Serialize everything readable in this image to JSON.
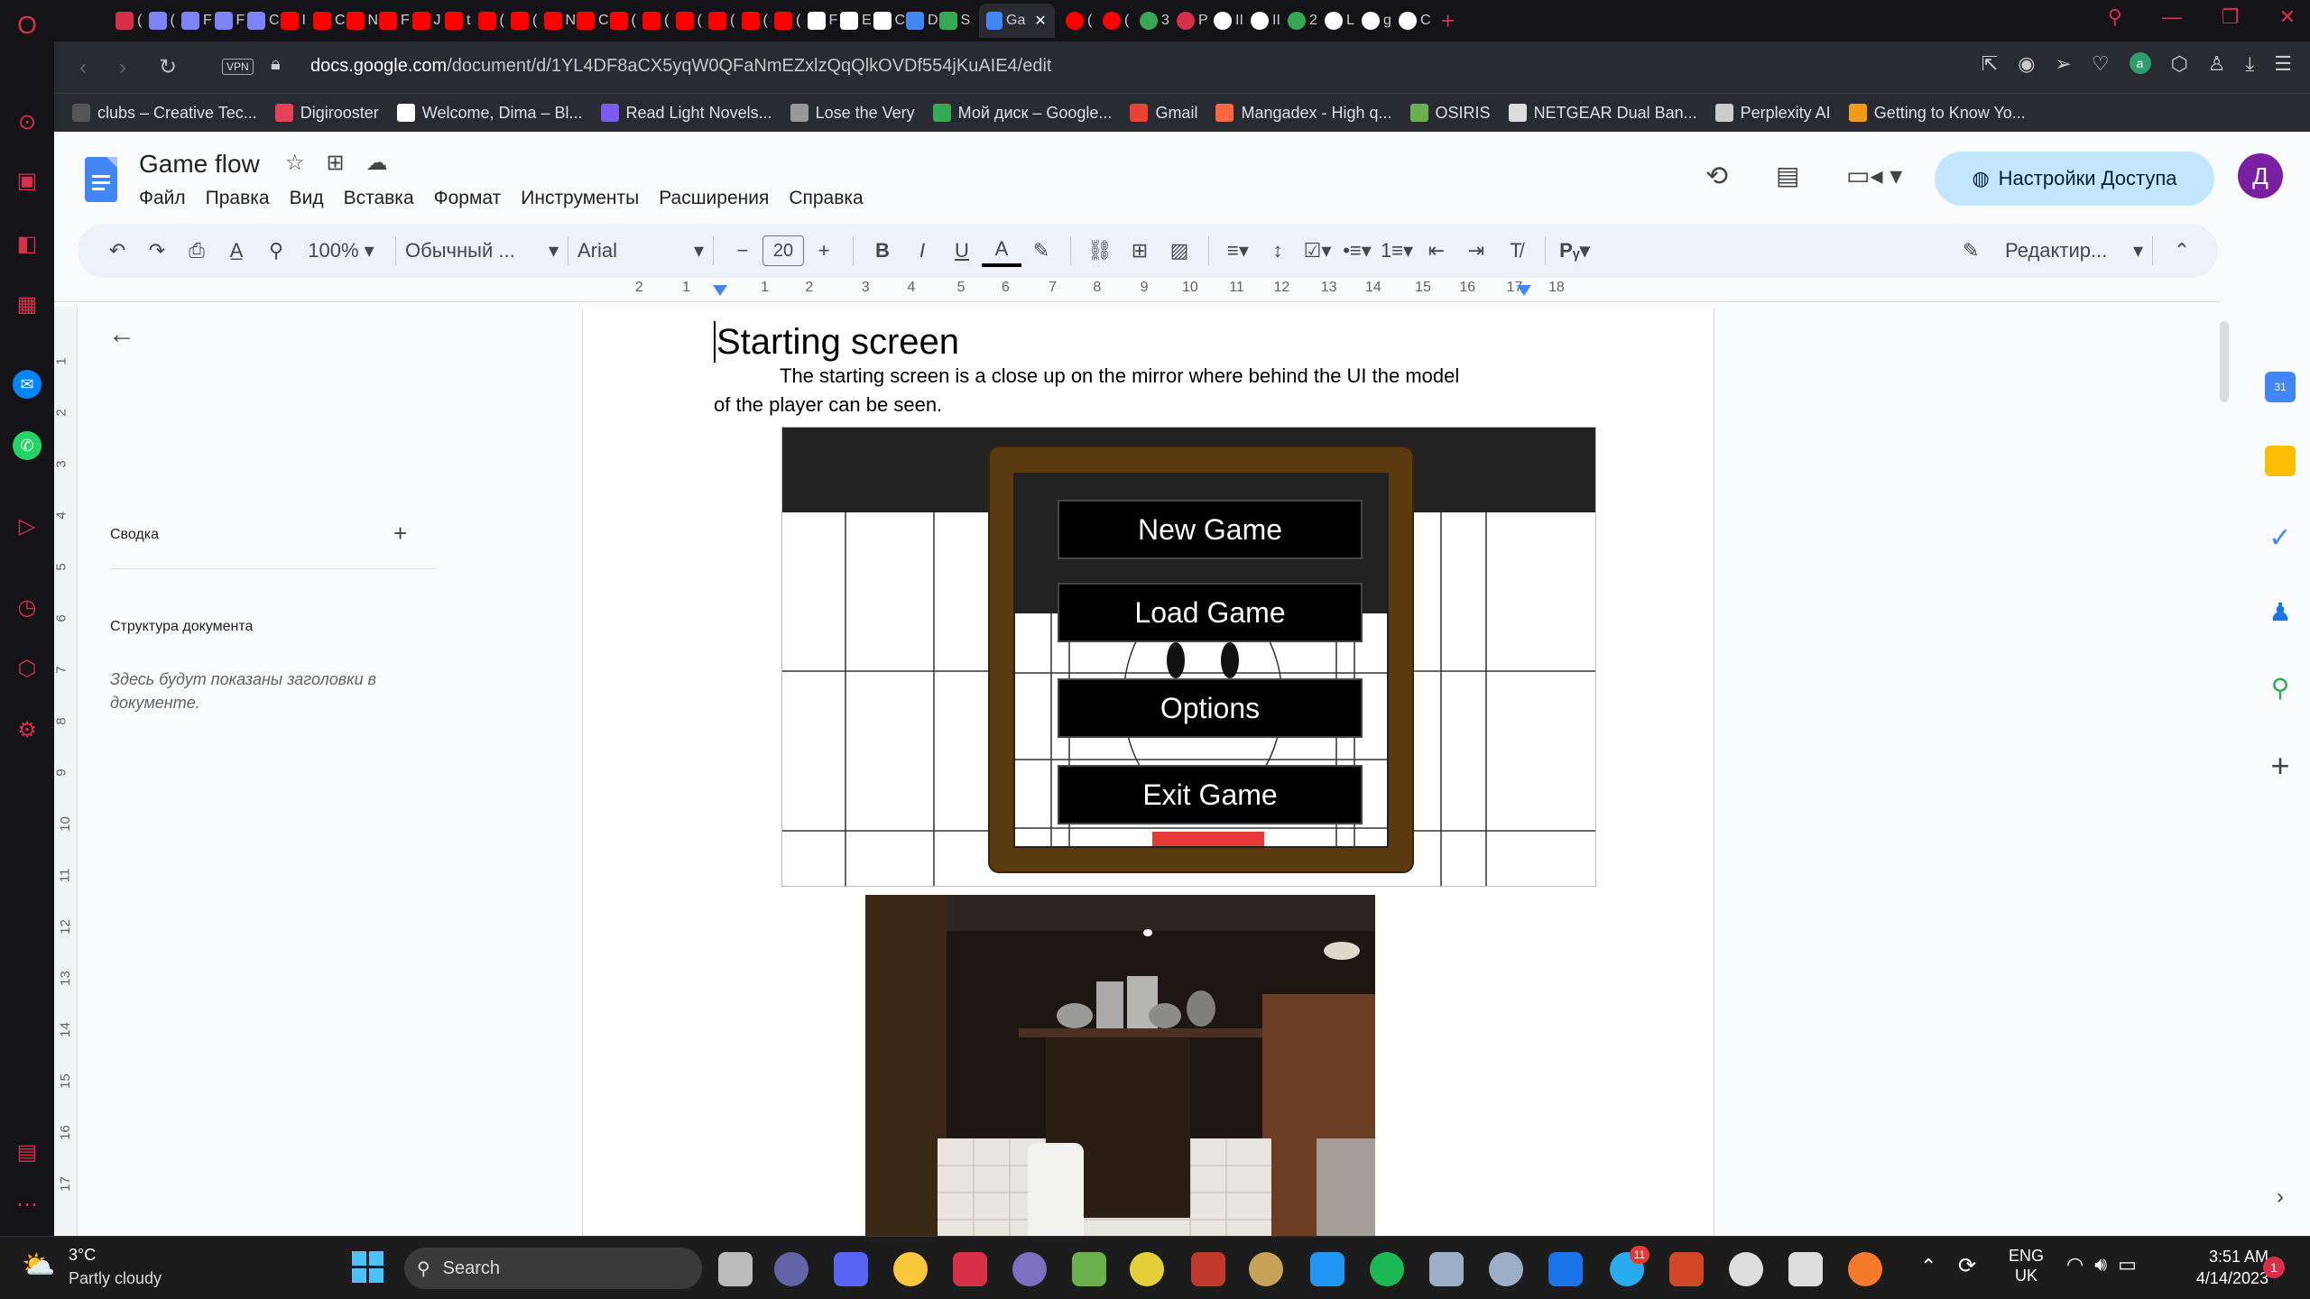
{
  "browser": {
    "tabs": [
      {
        "letter": "(",
        "icon": "gamepad-icon",
        "color": "#d9304a"
      },
      {
        "letter": "(",
        "icon": "tab-favicon",
        "color": "#7b83f6"
      },
      {
        "letter": "F",
        "icon": "tab-favicon",
        "color": "#7b83f6"
      },
      {
        "letter": "F",
        "icon": "tab-favicon",
        "color": "#7b83f6"
      },
      {
        "letter": "C",
        "icon": "tab-favicon",
        "color": "#7b83f6"
      },
      {
        "letter": "I",
        "icon": "youtube-icon",
        "color": "#ff0000"
      },
      {
        "letter": "C",
        "icon": "youtube-icon",
        "color": "#ff0000"
      },
      {
        "letter": "N",
        "icon": "youtube-icon",
        "color": "#ff0000"
      },
      {
        "letter": "F",
        "icon": "youtube-icon",
        "color": "#ff0000"
      },
      {
        "letter": "J",
        "icon": "youtube-icon",
        "color": "#ff0000"
      },
      {
        "letter": "t",
        "icon": "youtube-icon",
        "color": "#ff0000"
      },
      {
        "letter": "(",
        "icon": "youtube-icon",
        "color": "#ff0000"
      },
      {
        "letter": "(",
        "icon": "youtube-icon",
        "color": "#ff0000"
      },
      {
        "letter": "N",
        "icon": "youtube-icon",
        "color": "#ff0000"
      },
      {
        "letter": "C",
        "icon": "youtube-icon",
        "color": "#ff0000"
      },
      {
        "letter": "(",
        "icon": "youtube-icon",
        "color": "#ff0000"
      },
      {
        "letter": "(",
        "icon": "youtube-icon",
        "color": "#ff0000"
      },
      {
        "letter": "(",
        "icon": "youtube-icon",
        "color": "#ff0000"
      },
      {
        "letter": "(",
        "icon": "youtube-icon",
        "color": "#ff0000"
      },
      {
        "letter": "(",
        "icon": "youtube-icon",
        "color": "#ff0000"
      },
      {
        "letter": "(",
        "icon": "youtube-icon",
        "color": "#ff0000"
      },
      {
        "letter": "F",
        "icon": "behance-icon",
        "color": "#ffffff"
      },
      {
        "letter": "E",
        "icon": "behance-icon",
        "color": "#ffffff"
      },
      {
        "letter": "C",
        "icon": "tab-favicon",
        "color": "#ffffff"
      },
      {
        "letter": "D",
        "icon": "tab-favicon",
        "color": "#4285f4"
      },
      {
        "letter": "S",
        "icon": "drive-icon",
        "color": "#34a853"
      }
    ],
    "active_tab": {
      "label": "Ga",
      "icon": "docs-icon"
    },
    "tabs_after": [
      {
        "letter": "(",
        "icon": "youtube-icon",
        "color": "#ff0000"
      },
      {
        "letter": "(",
        "icon": "youtube-icon",
        "color": "#ff0000"
      },
      {
        "letter": "3",
        "icon": "maps-icon",
        "color": "#34a853"
      },
      {
        "letter": "P",
        "icon": "tab-favicon",
        "color": "#d9304a"
      },
      {
        "letter": "II",
        "icon": "tab-favicon",
        "color": "#ffffff"
      },
      {
        "letter": "II",
        "icon": "tab-favicon",
        "color": "#ffffff"
      },
      {
        "letter": "2",
        "icon": "maps-icon",
        "color": "#34a853"
      },
      {
        "letter": "L",
        "icon": "google-icon",
        "color": "#ffffff"
      },
      {
        "letter": "g",
        "icon": "google-icon",
        "color": "#ffffff"
      },
      {
        "letter": "C",
        "icon": "github-icon",
        "color": "#ffffff"
      }
    ],
    "vpn": "VPN",
    "url_domain": "docs.google.com",
    "url_path": "/document/d/1YL4DF8aCX5yqW0QFaNmEZxlzQqQlkOVDf554jKuAIE4/edit",
    "bookmarks": [
      {
        "label": "clubs – Creative Tec...",
        "color": "#555"
      },
      {
        "label": "Digirooster",
        "color": "#e8425a"
      },
      {
        "label": "Welcome, Dima – Bl...",
        "color": "#fff"
      },
      {
        "label": "Read Light Novels...",
        "color": "#7b5cf0"
      },
      {
        "label": "Lose the Very",
        "color": "#999"
      },
      {
        "label": "Мой диск – Google...",
        "color": "#34a853"
      },
      {
        "label": "Gmail",
        "color": "#ea4335"
      },
      {
        "label": "Mangadex - High q...",
        "color": "#ff6740"
      },
      {
        "label": "OSIRIS",
        "color": "#6ab04c"
      },
      {
        "label": "NETGEAR Dual Ban...",
        "color": "#ddd"
      },
      {
        "label": "Perplexity AI",
        "color": "#ccc"
      },
      {
        "label": "Getting to Know Yo...",
        "color": "#f39c12"
      }
    ]
  },
  "docs": {
    "title": "Game flow",
    "menu": [
      "Файл",
      "Правка",
      "Вид",
      "Вставка",
      "Формат",
      "Инструменты",
      "Расширения",
      "Справка"
    ],
    "share_label": "Настройки Доступа",
    "avatar_letter": "Д",
    "zoom": "100%",
    "style": "Обычный ...",
    "font": "Arial",
    "font_size": "20",
    "edit_mode": "Редактир...",
    "outline": {
      "summary": "Сводка",
      "structure": "Структура документа",
      "hint": "Здесь будут показаны заголовки в документе."
    },
    "ruler_numbers": [
      "2",
      "1",
      "1",
      "2",
      "3",
      "4",
      "5",
      "6",
      "7",
      "8",
      "9",
      "10",
      "11",
      "12",
      "13",
      "14",
      "15",
      "16",
      "17",
      "18"
    ],
    "vruler_numbers": [
      "1",
      "2",
      "3",
      "4",
      "5",
      "6",
      "7",
      "8",
      "9",
      "10",
      "11",
      "12",
      "13",
      "14",
      "15",
      "16",
      "17"
    ],
    "heading": "Starting screen",
    "paragraph_line1": "The starting screen is a close up on the mirror where behind the UI the model",
    "paragraph_line2": "of the player can be seen.",
    "menu_buttons": [
      "New Game",
      "Load Game",
      "Options",
      "Exit Game"
    ]
  },
  "taskbar": {
    "weather_temp": "3°C",
    "weather_desc": "Partly cloudy",
    "search": "Search",
    "lang_top": "ENG",
    "lang_bottom": "UK",
    "time": "3:51 AM",
    "date": "4/14/2023",
    "notifications": "1",
    "telegram_badge": "11"
  }
}
